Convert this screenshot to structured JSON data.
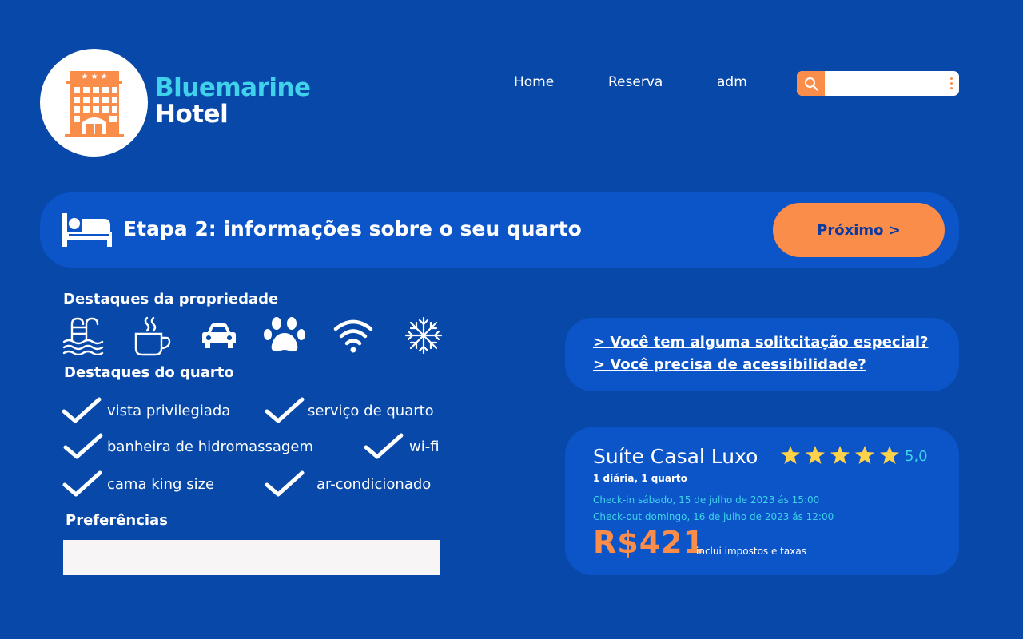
{
  "brand": {
    "line1": "Bluemarine",
    "line2": "Hotel"
  },
  "nav": {
    "home": "Home",
    "reserva": "Reserva",
    "adm": "adm"
  },
  "search": {
    "placeholder": ""
  },
  "step": {
    "title": "Etapa 2: informações sobre o seu quarto",
    "next_label": "Próximo >"
  },
  "property_highlights": {
    "heading": "Destaques da propriedade",
    "icons": [
      "pool-icon",
      "coffee-icon",
      "car-icon",
      "pet-icon",
      "wifi-icon",
      "snowflake-icon"
    ]
  },
  "room_highlights": {
    "heading": "Destaques do quarto",
    "items": [
      "vista privilegiada",
      "serviço de quarto",
      "banheira de hidromassagem",
      "wi-fi",
      "cama king size",
      "ar-condicionado"
    ]
  },
  "preferences": {
    "heading": "Preferências",
    "value": ""
  },
  "questions": {
    "special_request": "> Você tem alguma solitcitação especial?",
    "accessibility": "> Você precisa de acessibilidade?"
  },
  "room": {
    "name": "Suíte Casal Luxo",
    "stars": 5,
    "rating": "5,0",
    "summary": "1 diária, 1 quarto",
    "checkin": "Check-in sábado, 15 de julho de 2023 ás 15:00",
    "checkout": "Check-out domingo, 16 de julho de 2023 ás 12:00",
    "price": "R$421",
    "price_note": "inclui impostos e taxas"
  },
  "colors": {
    "background": "#0748a8",
    "panel": "#0b55c9",
    "accent_orange": "#fb8d4a",
    "accent_cyan": "#3fd2ea",
    "star": "#ffd24a"
  }
}
